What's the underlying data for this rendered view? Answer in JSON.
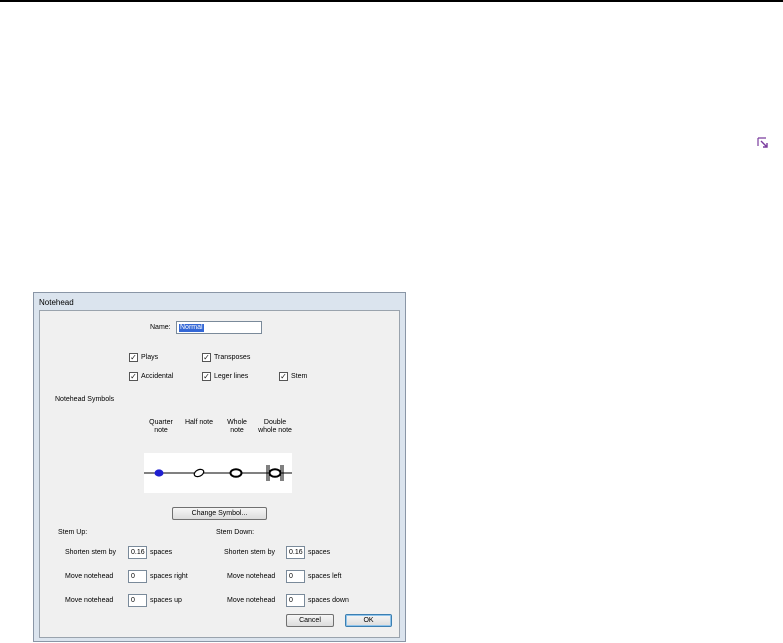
{
  "dialog": {
    "title": "Notehead",
    "name_label": "Name:",
    "name_value": "Normal",
    "checkboxes": {
      "plays": {
        "label": "Plays",
        "checked": true
      },
      "transposes": {
        "label": "Transposes",
        "checked": true
      },
      "accidental": {
        "label": "Accidental",
        "checked": true
      },
      "leger_lines": {
        "label": "Leger lines",
        "checked": true
      },
      "stem": {
        "label": "Stem",
        "checked": true
      }
    },
    "symbols_heading": "Notehead Symbols",
    "symbol_columns": [
      {
        "line1": "Quarter",
        "line2": "note"
      },
      {
        "line1": "Half note",
        "line2": ""
      },
      {
        "line1": "Whole",
        "line2": "note"
      },
      {
        "line1": "Double",
        "line2": "whole note"
      }
    ],
    "change_symbol_label": "Change Symbol...",
    "stem_up": {
      "heading": "Stem Up:",
      "shorten_label": "Shorten stem by",
      "shorten_value": "0.16",
      "shorten_unit": "spaces",
      "move1_label": "Move notehead",
      "move1_value": "0",
      "move1_unit": "spaces right",
      "move2_label": "Move notehead",
      "move2_value": "0",
      "move2_unit": "spaces up"
    },
    "stem_down": {
      "heading": "Stem Down:",
      "shorten_label": "Shorten stem by",
      "shorten_value": "0.16",
      "shorten_unit": "spaces",
      "move1_label": "Move notehead",
      "move1_value": "0",
      "move1_unit": "spaces left",
      "move2_label": "Move notehead",
      "move2_value": "0",
      "move2_unit": "spaces down"
    },
    "cancel_label": "Cancel",
    "ok_label": "OK"
  },
  "icons": {
    "corner": "dialog-launcher-icon",
    "check": "checkmark-icon"
  },
  "colors": {
    "quarter_note": "#1f1fd0",
    "selection": "#3367d6"
  }
}
